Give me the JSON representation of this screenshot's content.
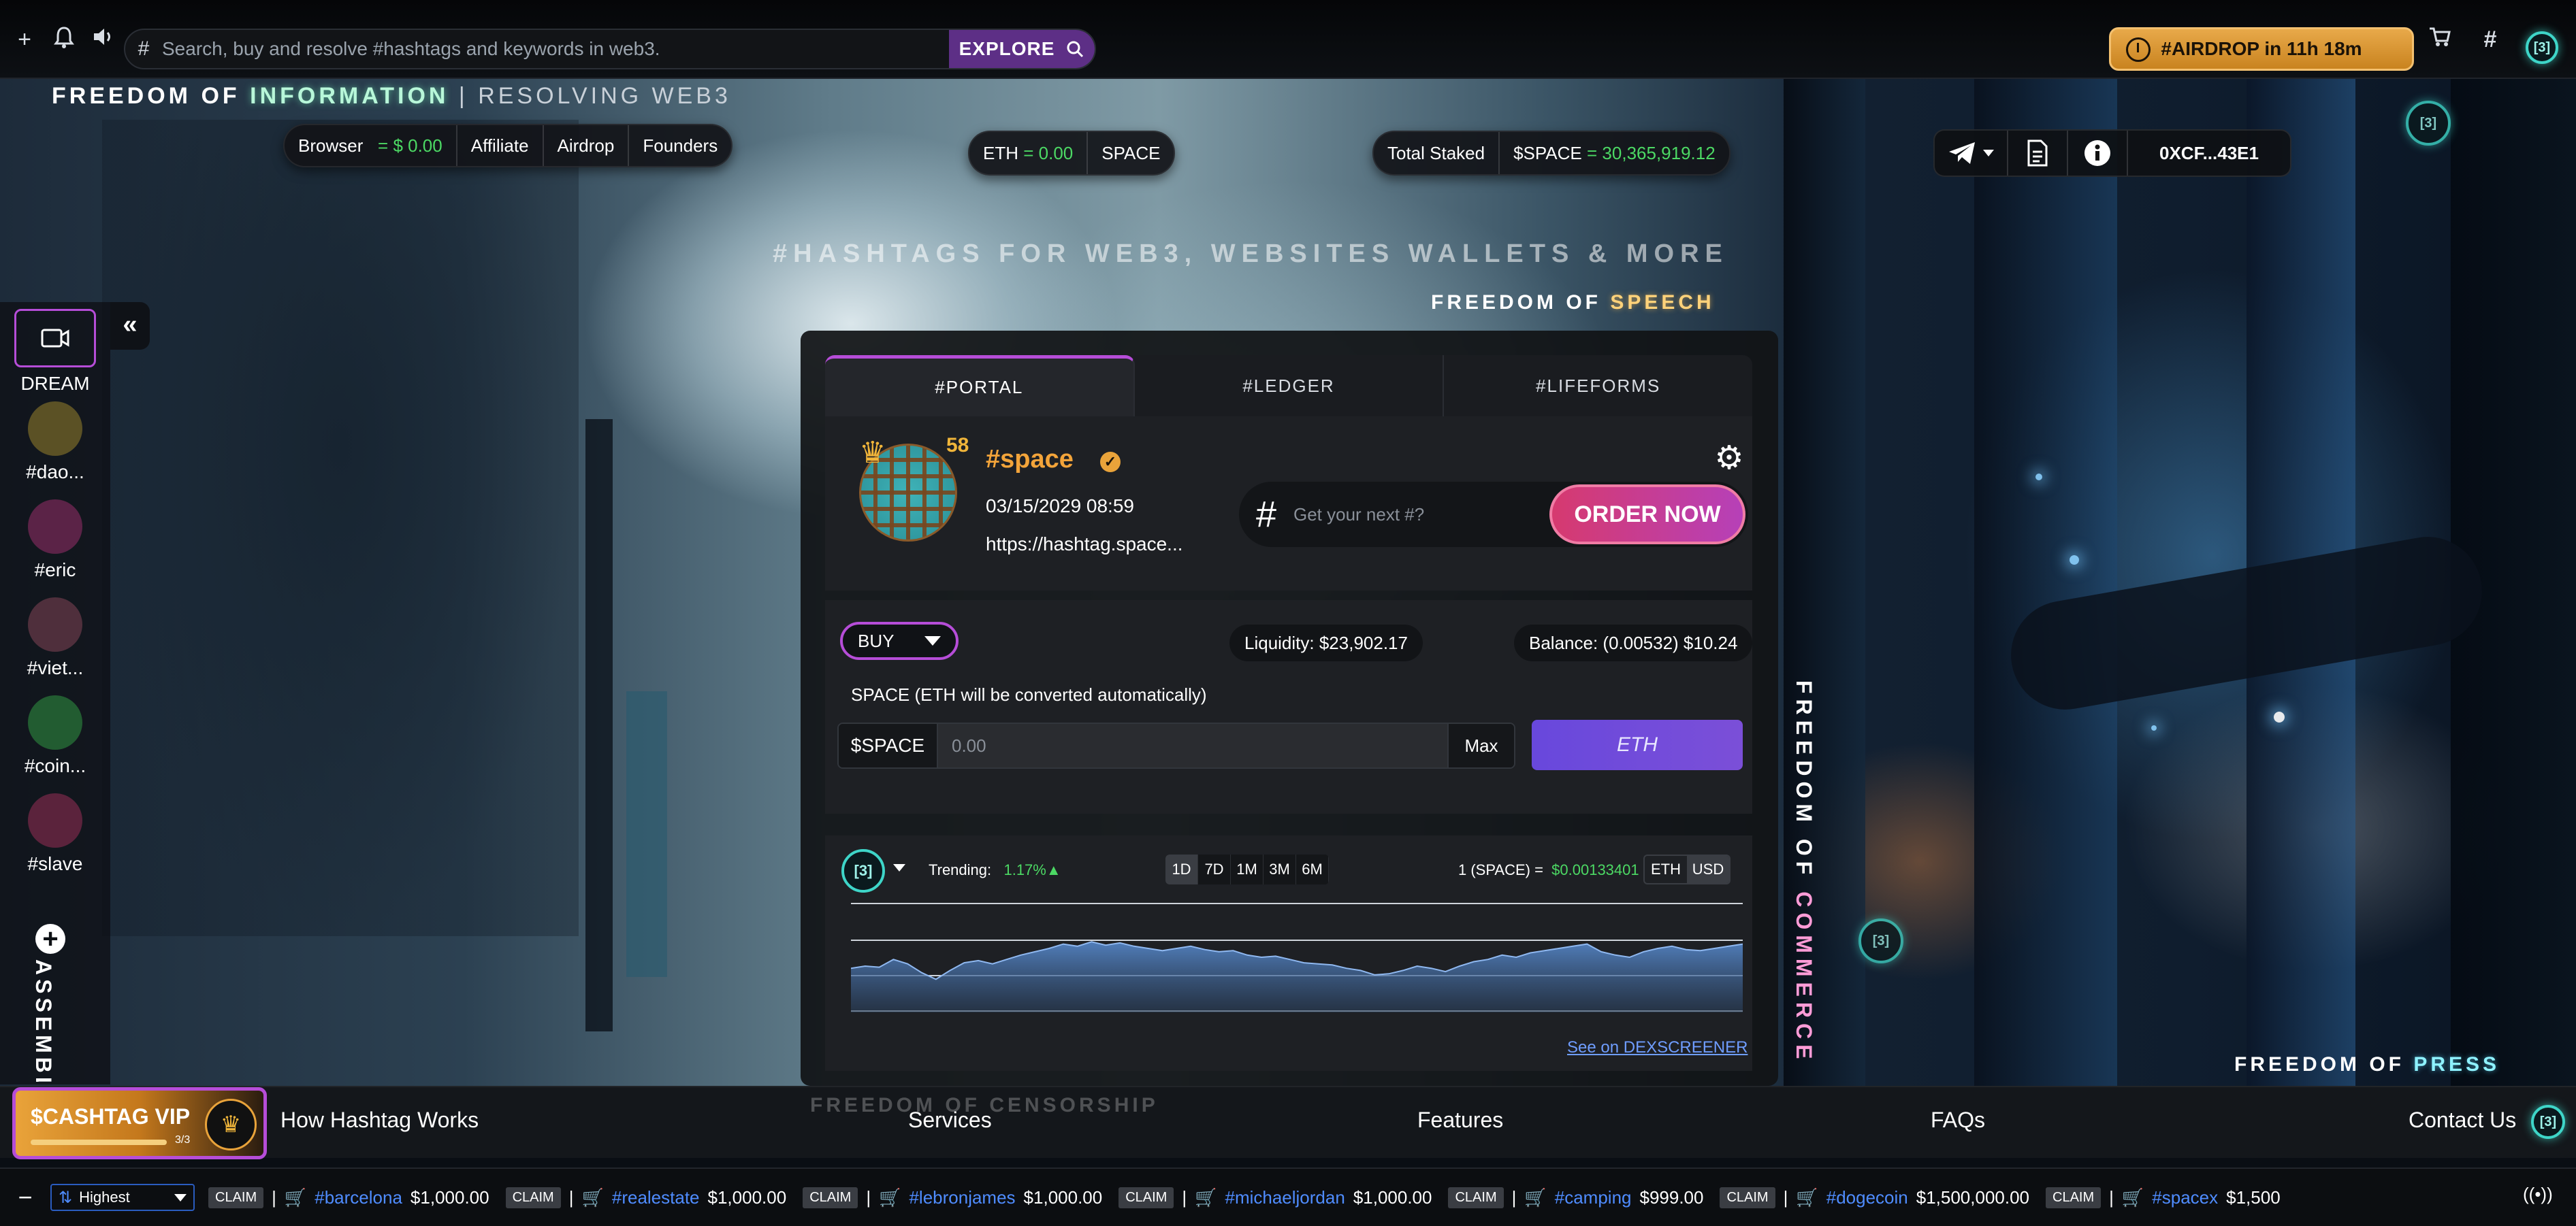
{
  "topbar": {
    "search_placeholder": "Search, buy and resolve #hashtags and keywords in web3.",
    "explore_label": "EXPLORE",
    "airdrop_label": "#AIRDROP in 11h 18m",
    "logo_text": "[3]"
  },
  "header": {
    "brand_part1": "FREEDOM OF",
    "brand_highlight": "INFORMATION",
    "brand_sep": "| RESOLVING WEB3",
    "browser_label": "Browser",
    "browser_value": "= $ 0.00",
    "affiliate_label": "Affiliate",
    "airdrop_link": "Airdrop",
    "founders_label": "Founders",
    "eth_label": "ETH",
    "eth_value": "= 0.00",
    "space_label": "SPACE",
    "total_staked_label": "Total Staked",
    "staked_prefix": "$SPACE",
    "staked_value": "= 30,365,919.12",
    "wallet_address": "0XCF...43E1"
  },
  "taglines": {
    "hashtags": "#HASHTAGS FOR WEB3, WEBSITES WALLETS & MORE",
    "speech_part": "FREEDOM OF",
    "speech_word": "SPEECH",
    "commerce_part": "FREEDOM OF",
    "commerce_word": "COMMERCE",
    "press_part": "FREEDOM OF",
    "press_word": "PRESS",
    "censorship": "FREEDOM OF CENSORSHIP",
    "assembly": "ASSEMBLY"
  },
  "sidebar": {
    "items": [
      {
        "label": "DREAM"
      },
      {
        "label": "#dao...",
        "color": "#7a6b2a"
      },
      {
        "label": "#eric",
        "color": "#7a2a5a"
      },
      {
        "label": "#viet...",
        "color": "#6a3a4a"
      },
      {
        "label": "#coin...",
        "color": "#2a7a3a"
      },
      {
        "label": "#slave",
        "color": "#7a2a4a"
      }
    ]
  },
  "portal": {
    "tabs": [
      "#PORTAL",
      "#LEDGER",
      "#LIFEFORMS"
    ],
    "profile": {
      "level": "58",
      "name": "#space",
      "date": "03/15/2029 08:59",
      "url": "https://hashtag.space..."
    },
    "order_placeholder": "Get your next #?",
    "order_button": "ORDER NOW",
    "trade": {
      "mode": "BUY",
      "liquidity": "Liquidity: $23,902.17",
      "balance": "Balance: (0.00532) $10.24",
      "note": "SPACE (ETH will be converted automatically)",
      "amount_prefix": "$SPACE",
      "amount_placeholder": "0.00",
      "max_label": "Max",
      "eth_button": "ETH"
    },
    "chart": {
      "trending_label": "Trending:",
      "trending_value": "1.17%▲",
      "ranges": [
        "1D",
        "7D",
        "1M",
        "3M",
        "6M"
      ],
      "active_range": "1D",
      "rate_prefix": "1 (SPACE) =",
      "rate_value": "$0.00133401",
      "currencies": [
        "ETH",
        "USD"
      ],
      "active_currency": "USD",
      "dex_link": "See on DEXSCREENER"
    }
  },
  "chart_data": {
    "type": "area",
    "title": "",
    "xlabel": "",
    "ylabel": "",
    "ylim": [
      0,
      100
    ],
    "values": [
      40,
      42,
      41,
      48,
      44,
      36,
      30,
      38,
      45,
      47,
      44,
      48,
      52,
      55,
      58,
      62,
      60,
      64,
      61,
      63,
      60,
      58,
      56,
      58,
      60,
      57,
      55,
      56,
      52,
      50,
      51,
      48,
      45,
      44,
      43,
      40,
      38,
      34,
      35,
      38,
      42,
      40,
      37,
      42,
      46,
      48,
      52,
      50,
      54,
      56,
      58,
      60,
      62,
      55,
      52,
      50,
      55,
      58,
      60,
      57,
      56,
      58,
      60,
      62
    ]
  },
  "bottom_nav": {
    "vip_title": "$CASHTAG VIP",
    "vip_count": "3/3",
    "links": [
      "How Hashtag Works",
      "Services",
      "Features",
      "FAQs",
      "Contact Us"
    ]
  },
  "ticker": {
    "sort_label": "Highest",
    "claim_label": "CLAIM",
    "items": [
      {
        "tag": "#barcelona",
        "value": "$1,000.00"
      },
      {
        "tag": "#realestate",
        "value": "$1,000.00"
      },
      {
        "tag": "#lebronjames",
        "value": "$1,000.00"
      },
      {
        "tag": "#michaeljordan",
        "value": "$1,000.00"
      },
      {
        "tag": "#camping",
        "value": "$999.00"
      },
      {
        "tag": "#dogecoin",
        "value": "$1,500,000.00"
      },
      {
        "tag": "#spacex",
        "value": "$1,500"
      }
    ]
  }
}
